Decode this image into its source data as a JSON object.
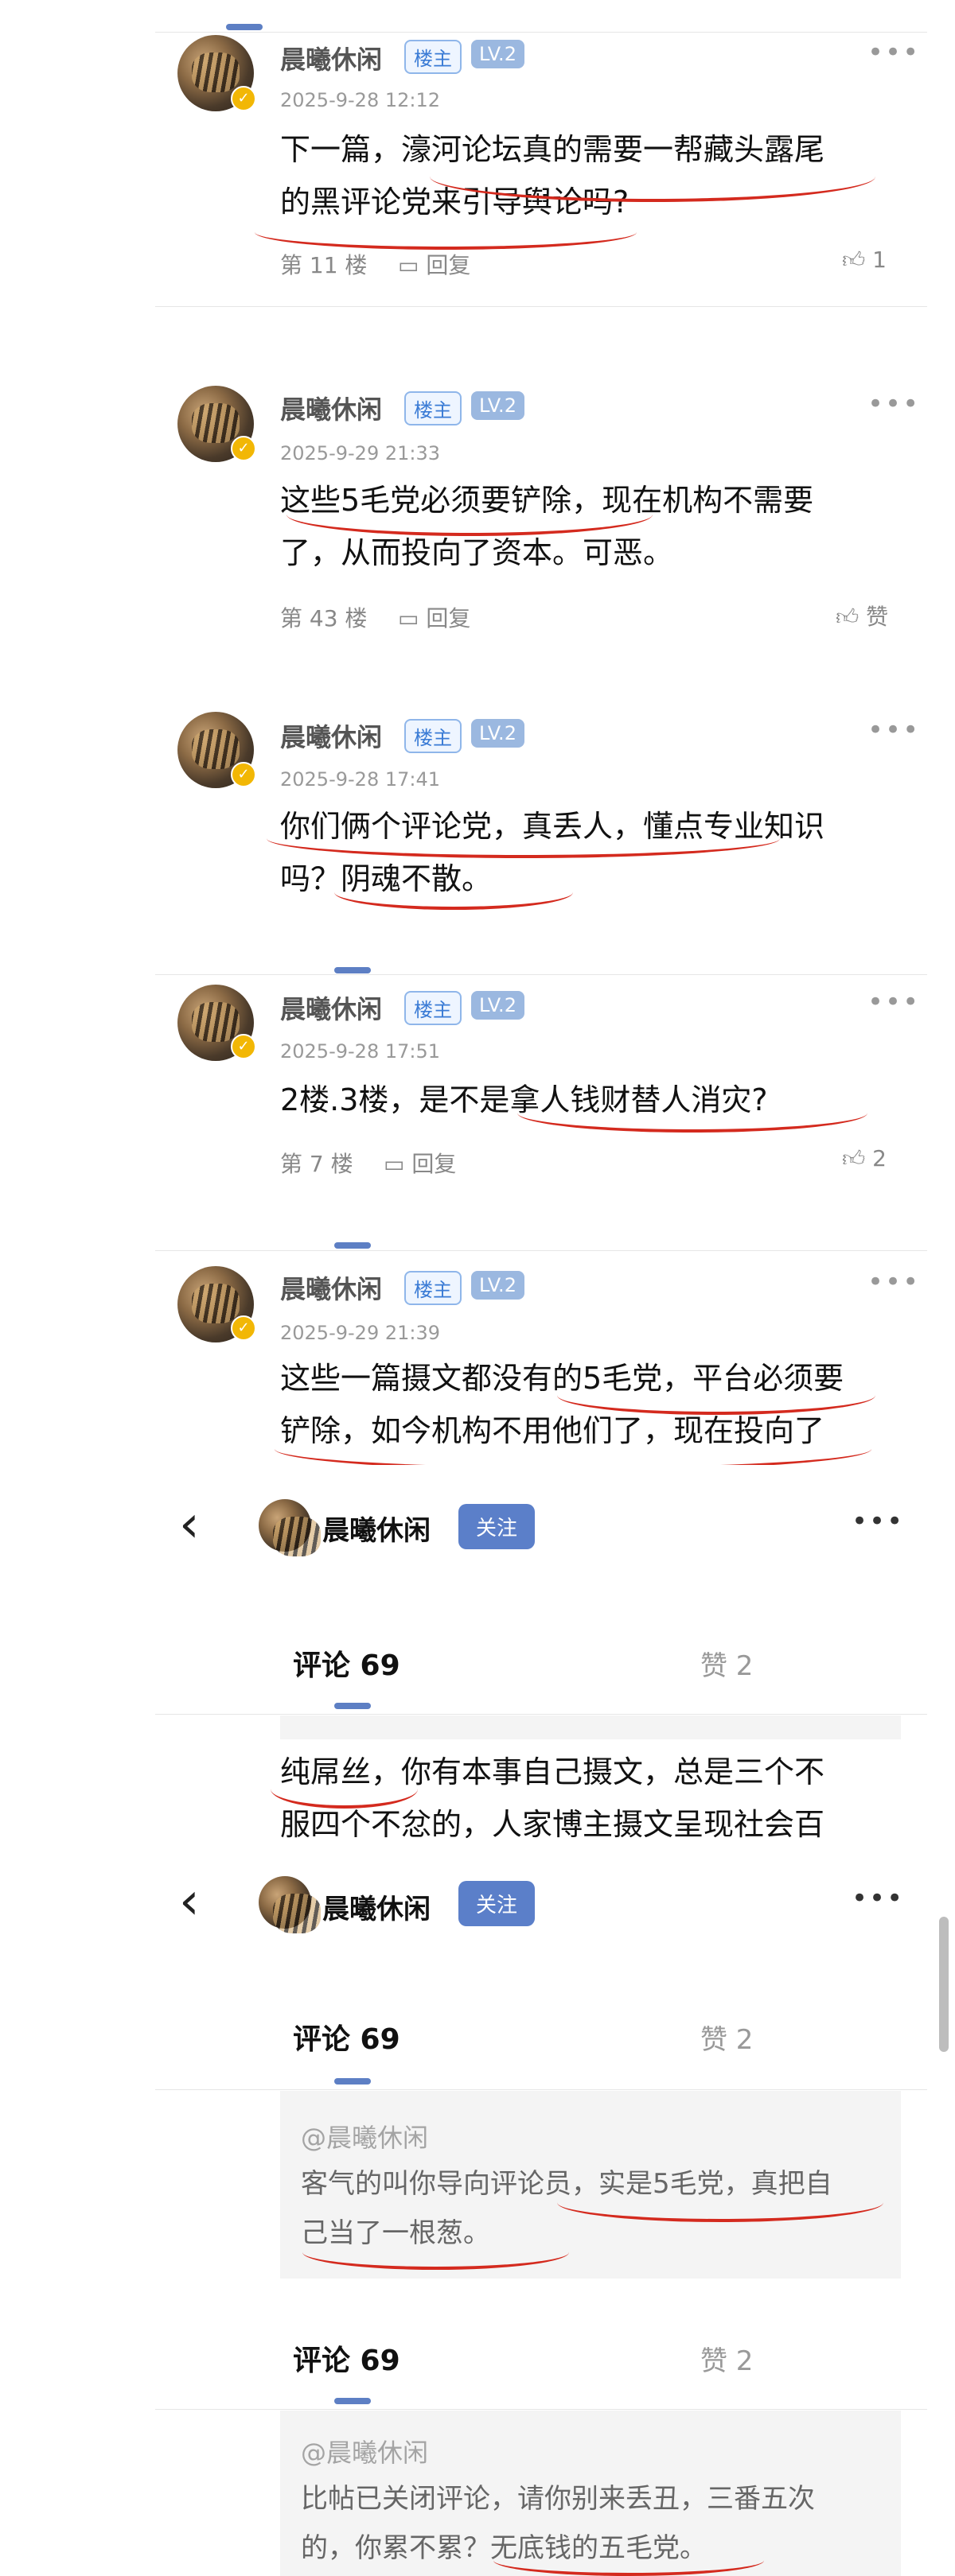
{
  "posts": [
    {
      "user": "晨曦休闲",
      "host_tag": "楼主",
      "level": "LV.2",
      "verified": "✓",
      "date": "2025-9-28 12:12",
      "lines": [
        "下一篇，濠河论坛真的需要一帮藏头露尾",
        "的黑评论党来引导舆论吗?"
      ],
      "floor": "第 11 楼",
      "reply": "回复",
      "likes": "1"
    },
    {
      "user": "晨曦休闲",
      "host_tag": "楼主",
      "level": "LV.2",
      "verified": "✓",
      "date": "2025-9-29 21:33",
      "lines": [
        "这些5毛党必须要铲除，现在机构不需要",
        "了，从而投向了资本。可恶。"
      ],
      "floor": "第 43 楼",
      "reply": "回复",
      "likes": "赞"
    },
    {
      "user": "晨曦休闲",
      "host_tag": "楼主",
      "level": "LV.2",
      "verified": "✓",
      "date": "2025-9-28 17:41",
      "lines": [
        "你们俩个评论党，真丢人，懂点专业知识",
        "吗？阴魂不散。"
      ]
    },
    {
      "user": "晨曦休闲",
      "host_tag": "楼主",
      "level": "LV.2",
      "verified": "✓",
      "date": "2025-9-28 17:51",
      "lines": [
        "2楼.3楼，是不是拿人钱财替人消灾?"
      ],
      "floor": "第 7 楼",
      "reply": "回复",
      "likes": "2"
    },
    {
      "user": "晨曦休闲",
      "host_tag": "楼主",
      "level": "LV.2",
      "verified": "✓",
      "date": "2025-9-29 21:39",
      "lines": [
        "这些一篇摄文都没有的5毛党，平台必须要",
        "铲除，如今机构不用他们了，现在投向了"
      ]
    }
  ],
  "header": {
    "user": "晨曦休闲",
    "follow": "关注",
    "more": "•••",
    "back": "‹"
  },
  "tabs": {
    "comments": "评论 69",
    "likes": "赞 2"
  },
  "section1_text": [
    "纯屌丝，你有本事自己摄文，总是三个不",
    "服四个不忿的，人家博主摄文呈现社会百"
  ],
  "quote1": {
    "user": "@晨曦休闲",
    "lines": [
      "客气的叫你导向评论员，实是5毛党，真把自",
      "己当了一根葱。"
    ]
  },
  "quote2": {
    "user": "@晨曦休闲",
    "lines": [
      "比帖已关闭评论，请你别来丢丑，三番五次",
      "的，你累不累？无底钱的五毛党。"
    ]
  }
}
